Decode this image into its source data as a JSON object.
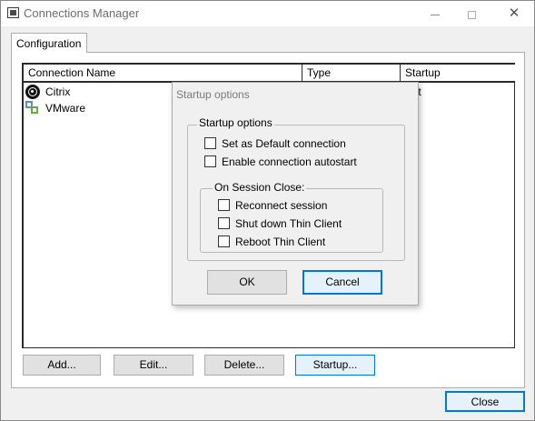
{
  "window": {
    "title": "Connections Manager",
    "minimize_glyph": "",
    "close_glyph": "✕"
  },
  "tabs": [
    {
      "label": "Configuration",
      "selected": true
    }
  ],
  "list": {
    "columns": [
      "Connection Name",
      "Type",
      "Startup"
    ],
    "rows": [
      {
        "name": "Citrix",
        "icon": "citrix-icon",
        "type": "",
        "startup": "fault"
      },
      {
        "name": "VMware",
        "icon": "vmware-icon",
        "type": "",
        "startup": ""
      }
    ]
  },
  "buttons": {
    "add": "Add...",
    "edit": "Edit...",
    "delete": "Delete...",
    "startup": "Startup...",
    "close": "Close"
  },
  "dialog": {
    "title": "Startup options",
    "group_caption": "Startup options",
    "options": [
      {
        "label": "Set as Default connection",
        "checked": false
      },
      {
        "label": "Enable connection autostart",
        "checked": false
      }
    ],
    "session_close_caption": "On Session Close:",
    "session_close_options": [
      {
        "label": "Reconnect session",
        "checked": false
      },
      {
        "label": "Shut down Thin Client",
        "checked": false
      },
      {
        "label": "Reboot Thin Client",
        "checked": false
      }
    ],
    "ok_label": "OK",
    "cancel_label": "Cancel"
  },
  "colors": {
    "focus_border": "#0078d7",
    "window_bg": "#f0f0f0",
    "button_bg": "#e1e1e1"
  }
}
